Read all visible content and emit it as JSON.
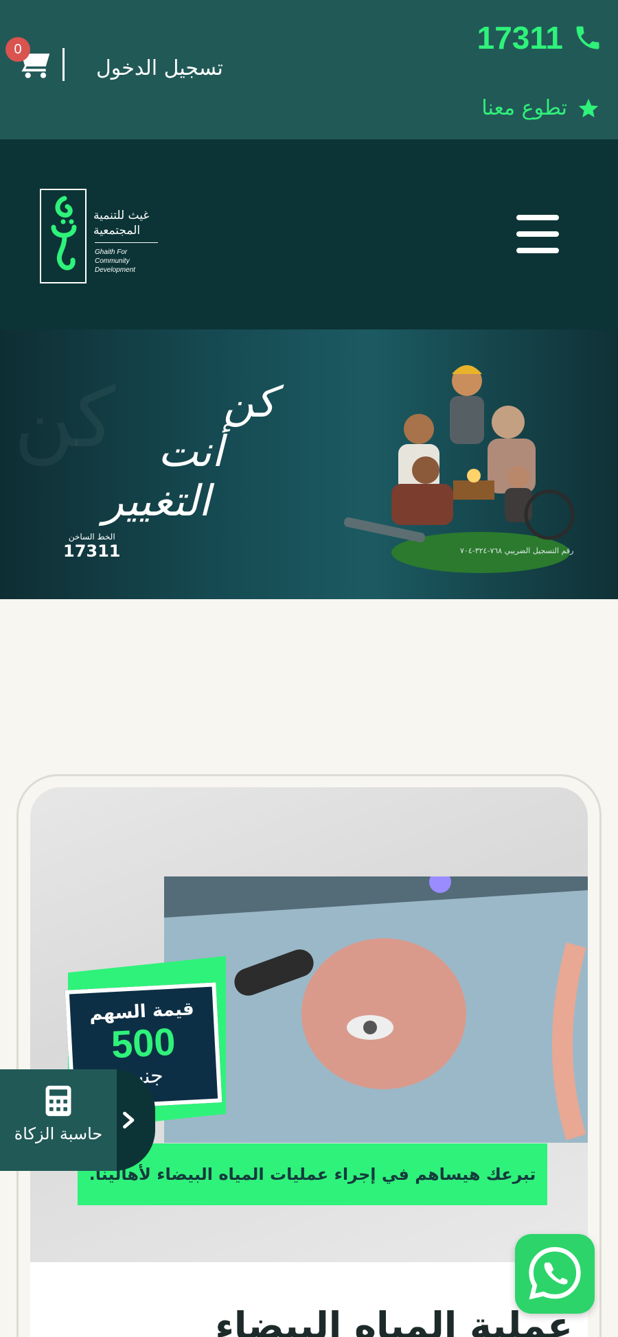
{
  "topbar": {
    "phone": "17311",
    "volunteer": "تطوع معنا",
    "login": "تسجيل الدخول",
    "cart_count": "0"
  },
  "header": {
    "logo_ar_line1": "غيث للتنمية",
    "logo_ar_line2": "المجتمعية",
    "logo_en_line1": "Ghaith For Community",
    "logo_en_line2": "Development"
  },
  "hero": {
    "slogan_line1": "كن",
    "slogan_line2": "أنت",
    "slogan_line3": "التغيير",
    "hotline_label": "الخط الساخن",
    "hotline_number": "17311",
    "registration": "رقم التسجيل الضريبي ٧٦٨-٣٢٤-٧٠٤"
  },
  "card": {
    "share_label": "قيمة السهم",
    "share_value": "500",
    "share_currency": "جنيه",
    "banner_text": "تبرعك هيساهم في إجراء عمليات المياه البيضاء لأهالينا.",
    "title": "عملية المياه البيضاء"
  },
  "zakat": {
    "label": "حاسبة الزكاة"
  },
  "colors": {
    "accent_green": "#2ff27a",
    "topbar": "#215957",
    "header": "#0c3436",
    "page_bg": "#f8f6f1"
  },
  "icons": [
    "phone-icon",
    "star-icon",
    "cart-icon",
    "hamburger-icon",
    "calculator-icon",
    "chevron-right-icon",
    "whatsapp-icon"
  ]
}
